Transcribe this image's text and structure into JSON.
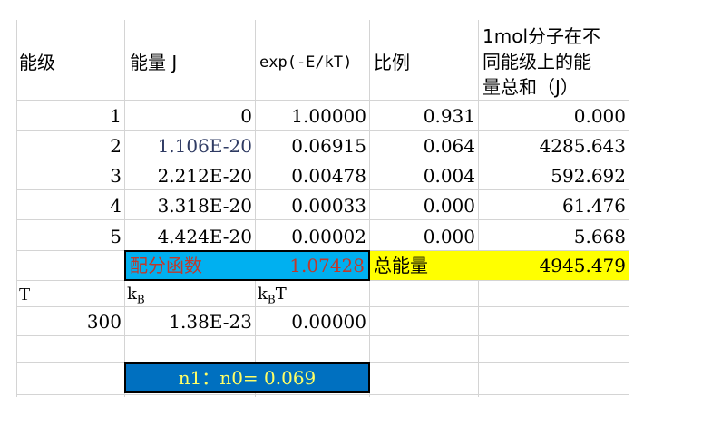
{
  "headers": {
    "level": "能级",
    "energy": "能量 J",
    "exp": "exp(-E/kT)",
    "ratio": "比例",
    "total_line1": "1mol分子在不",
    "total_line2": "同能级上的能",
    "total_line3": "量总和（J）"
  },
  "rows": [
    {
      "level": "1",
      "energy": "0",
      "exp": "1.00000",
      "ratio": "0.931",
      "total": "0.000"
    },
    {
      "level": "2",
      "energy": "1.106E-20",
      "exp": "0.06915",
      "ratio": "0.064",
      "total": "4285.643"
    },
    {
      "level": "3",
      "energy": "2.212E-20",
      "exp": "0.00478",
      "ratio": "0.004",
      "total": "592.692"
    },
    {
      "level": "4",
      "energy": "3.318E-20",
      "exp": "0.00033",
      "ratio": "0.000",
      "total": "61.476"
    },
    {
      "level": "5",
      "energy": "4.424E-20",
      "exp": "0.00002",
      "ratio": "0.000",
      "total": "5.668"
    }
  ],
  "partition": {
    "label": "配分函数",
    "value": "1.07428",
    "total_label": "总能量",
    "total_value": "4945.479"
  },
  "constants": {
    "t_label": "T",
    "kb_label": "k",
    "kb_sub": "B",
    "kbt_label_k": "k",
    "kbt_label_sub": "B",
    "kbt_label_t": "T",
    "t_value": "300",
    "kb_value": "1.38E-23",
    "kbt_value": "0.00000"
  },
  "ratio_box": {
    "text": "n1：n0= 0.069"
  },
  "colors": {
    "cyan_fill": "#00b0f0",
    "yellow_fill": "#ffff00",
    "blue_fill": "#0070c0",
    "box_text": "#ffff66",
    "grid": "#d4d4d4"
  }
}
